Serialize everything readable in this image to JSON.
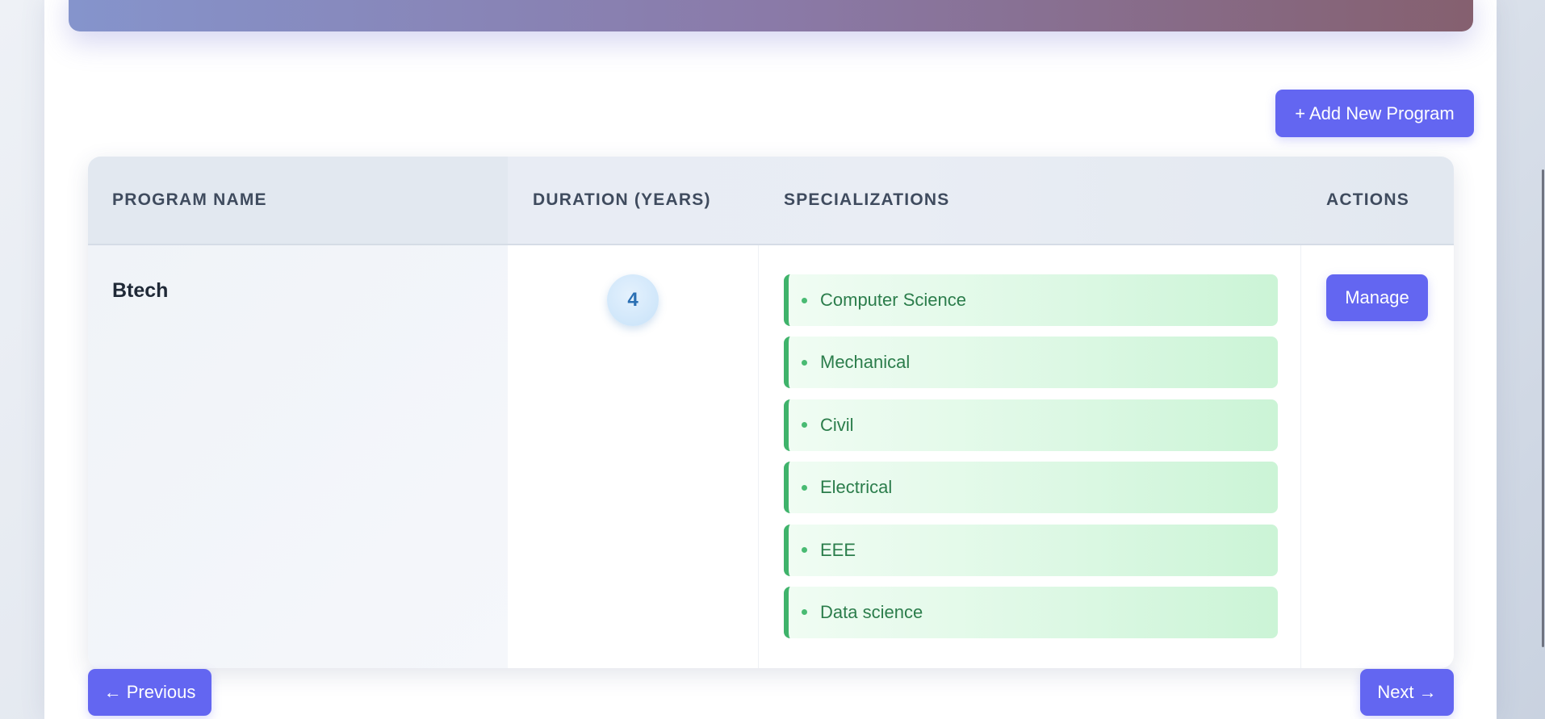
{
  "toolbar": {
    "add_program_label": "+ Add New Program"
  },
  "table": {
    "headers": {
      "program_name": "PROGRAM NAME",
      "duration": "DURATION (YEARS)",
      "specializations": "SPECIALIZATIONS",
      "actions": "ACTIONS"
    },
    "rows": [
      {
        "program_name": "Btech",
        "duration": "4",
        "specializations": [
          "Computer Science",
          "Mechanical",
          "Civil",
          "Electrical",
          "EEE",
          "Data science"
        ],
        "action_label": "Manage"
      }
    ]
  },
  "pagination": {
    "previous_label": "← Previous",
    "next_label": "Next →"
  },
  "colors": {
    "accent": "#6366f1",
    "specialization_text": "#2b7d4b",
    "specialization_border": "#3fb36b",
    "duration_badge_text": "#2a6fb3"
  }
}
